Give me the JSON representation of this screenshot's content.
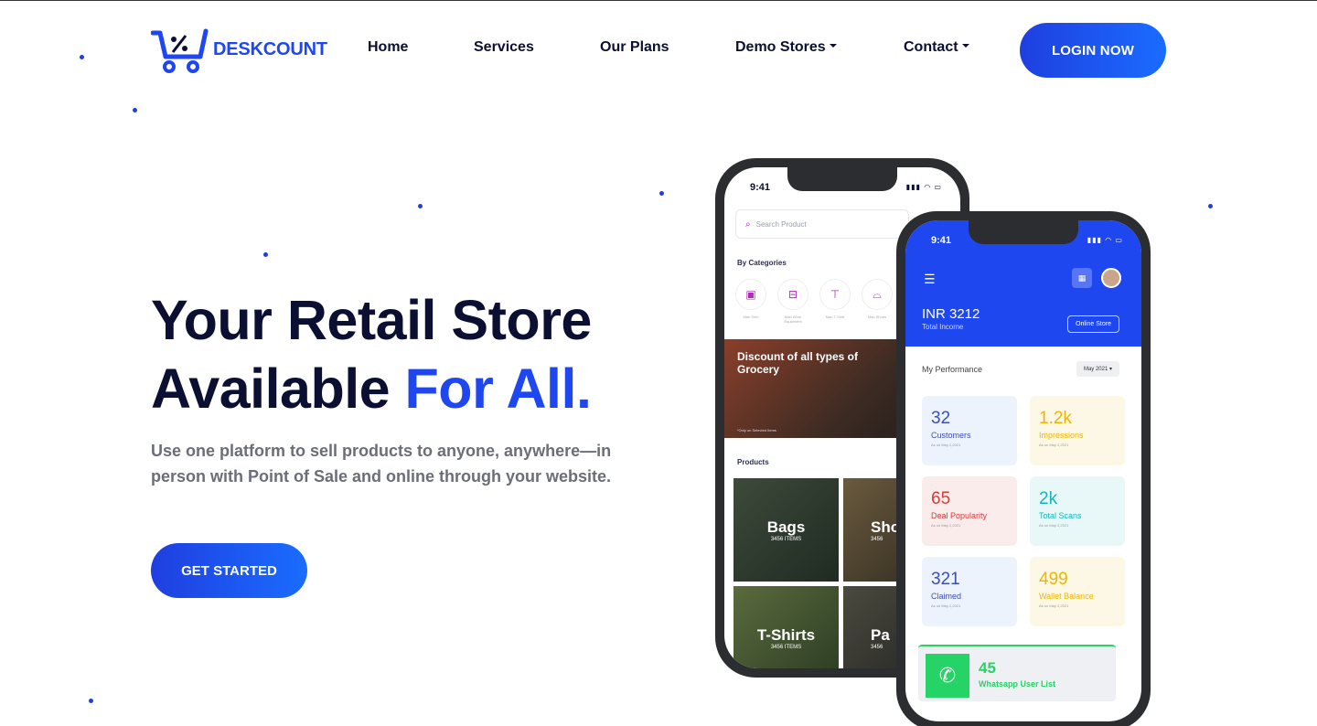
{
  "brand": {
    "name": "DESKCOUNT",
    "accent": "#1f47f0",
    "dark": "#0b1033"
  },
  "nav": {
    "home": "Home",
    "services": "Services",
    "plans": "Our Plans",
    "demo_stores": "Demo Stores",
    "contact": "Contact",
    "login": "LOGIN NOW"
  },
  "hero": {
    "title_line1": "Your Retail Store",
    "title_line2_prefix": "Available ",
    "title_line2_accent": "For All.",
    "subtitle": "Use one platform to sell products to anyone, anywhere—in person with Point of Sale and online through your website.",
    "cta": "GET STARTED"
  },
  "phone1": {
    "time": "9:41",
    "search_placeholder": "Search Product",
    "categories_title": "By Categories",
    "categories": [
      {
        "label": "Man Shirt",
        "icon": "shirt-icon"
      },
      {
        "label": "Man Work Equipment",
        "icon": "bag-icon"
      },
      {
        "label": "Man T-Shirt",
        "icon": "tshirt-icon"
      },
      {
        "label": "Man Shoes",
        "icon": "shoe-icon"
      }
    ],
    "promo_title": "Discount of all types of Grocery",
    "promo_note": "*Only on Selected Items",
    "products_title": "Products",
    "products": [
      {
        "name": "Bags",
        "count": "3456 ITEMS"
      },
      {
        "name": "Sho",
        "count": "3456"
      },
      {
        "name": "T-Shirts",
        "count": "3456 ITEMS"
      },
      {
        "name": "Pa",
        "count": "3456"
      }
    ]
  },
  "phone2": {
    "time": "9:41",
    "income_value": "INR 3212",
    "income_label": "Total Income",
    "online_store": "Online Store",
    "performance_title": "My Performance",
    "month": "May 2021",
    "cards": [
      {
        "value": "32",
        "label": "Customers",
        "date": "As on May 2,2021",
        "color": "#3b4fb8",
        "bg": "#ecf3fc"
      },
      {
        "value": "1.2k",
        "label": "Impressions",
        "date": "As on May 2,2021",
        "color": "#f0b400",
        "bg": "#fdf8e6"
      },
      {
        "value": "65",
        "label": "Deal Popularity",
        "date": "As on May 2,2021",
        "color": "#d93a3a",
        "bg": "#fbecec"
      },
      {
        "value": "2k",
        "label": "Total Scans",
        "date": "As on May 2,2021",
        "color": "#12b5c0",
        "bg": "#e8f8f9"
      },
      {
        "value": "321",
        "label": "Claimed",
        "date": "As on May 2,2021",
        "color": "#3b4fb8",
        "bg": "#ecf3fc"
      },
      {
        "value": "499",
        "label": "Wallet Balance",
        "date": "As on May 2,2021",
        "color": "#f0b400",
        "bg": "#fdf8e6"
      }
    ],
    "whatsapp_value": "45",
    "whatsapp_label": "Whatsapp User List"
  }
}
